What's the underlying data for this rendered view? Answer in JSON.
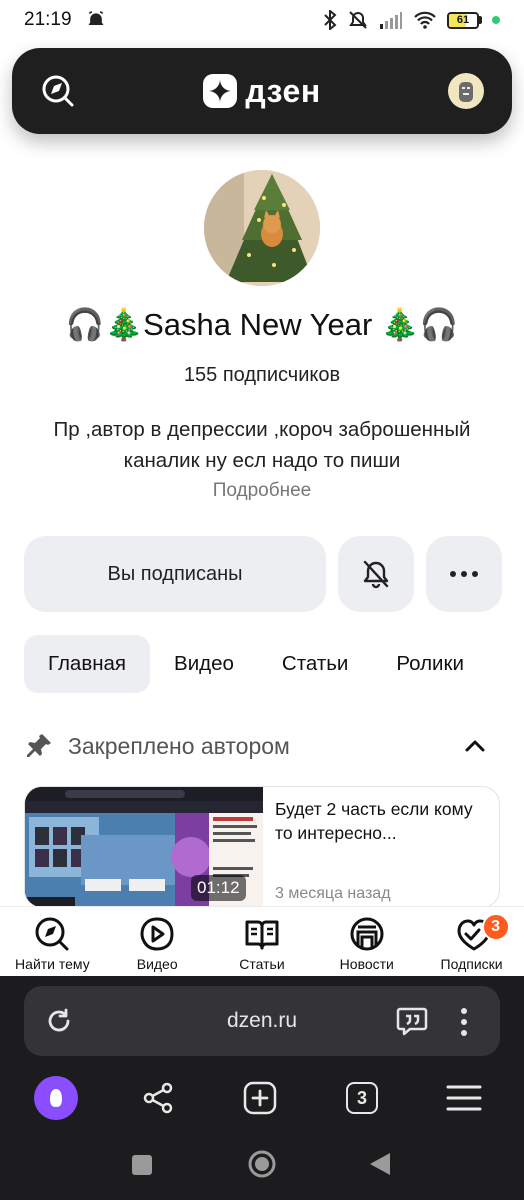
{
  "status_bar": {
    "time": "21:19",
    "battery_level": "61",
    "battery_fill_percent": 61
  },
  "header": {
    "logo_text": "дзен",
    "search_icon": "search-compass-icon",
    "avatar_icon": "user-avatar-icon"
  },
  "profile": {
    "name": "🎧🎄Sasha New Year 🎄🎧",
    "subscribers_count": "155",
    "subscribers_label": "подписчиков",
    "description": "Пр ,автор в депрессии ,короч заброшенный каналик ну есл надо то пиши",
    "more_link": "Подробнее"
  },
  "actions": {
    "subscribed_label": "Вы подписаны",
    "bell_icon": "bell-off-icon",
    "more_icon": "more-horizontal-icon"
  },
  "tabs": [
    {
      "label": "Главная",
      "active": true
    },
    {
      "label": "Видео",
      "active": false
    },
    {
      "label": "Статьи",
      "active": false
    },
    {
      "label": "Ролики",
      "active": false
    }
  ],
  "pinned": {
    "title": "Закреплено автором",
    "card": {
      "title": "Будет 2 часть если кому то интересно...",
      "duration": "01:12",
      "date": "3 месяца назад"
    }
  },
  "bottom_nav": [
    {
      "label": "Найти тему",
      "icon": "compass-search-icon"
    },
    {
      "label": "Видео",
      "icon": "video-play-icon"
    },
    {
      "label": "Статьи",
      "icon": "book-icon"
    },
    {
      "label": "Новости",
      "icon": "news-icon"
    },
    {
      "label": "Подписки",
      "icon": "subscriptions-icon",
      "badge": "3"
    }
  ],
  "browser": {
    "url": "dzen.ru",
    "tab_count": "3"
  },
  "colors": {
    "header_bg": "#1f1f1f",
    "chip_bg": "#edeef2",
    "badge": "#ff5a1f",
    "alice": "#8a4dff",
    "browser_bg": "#1c1c1e"
  }
}
